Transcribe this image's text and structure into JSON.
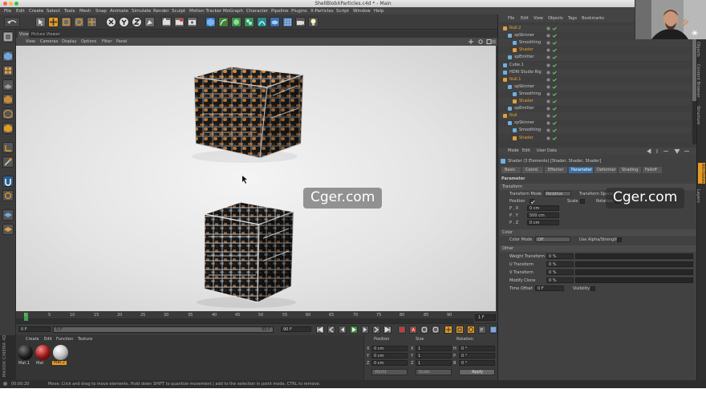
{
  "window": {
    "title": "ShellBlobXParticles.c4d * - Main"
  },
  "menu": [
    "File",
    "Edit",
    "Create",
    "Select",
    "Tools",
    "Mesh",
    "Snap",
    "Animate",
    "Simulate",
    "Render",
    "Sculpt",
    "Motion Tracker",
    "MoGraph",
    "Character",
    "Pipeline",
    "Plugins",
    "X-Particles",
    "Script",
    "Window",
    "Help"
  ],
  "viewport": {
    "tabs": [
      "View",
      "Picture Viewer"
    ],
    "menu": [
      "View",
      "Cameras",
      "Display",
      "Options",
      "Filter",
      "Panel"
    ]
  },
  "timeline": {
    "ticks": [
      "0",
      "5",
      "10",
      "15",
      "20",
      "25",
      "30",
      "35",
      "40",
      "45",
      "50",
      "55",
      "60",
      "65",
      "70",
      "75",
      "80",
      "85",
      "90"
    ],
    "frame_readout": "1 F"
  },
  "transport": {
    "start": "0 F",
    "range_start": "0 F",
    "range_end": "90 F",
    "end": "90 F"
  },
  "material_manager": {
    "menu": [
      "Create",
      "Edit",
      "Function",
      "Texture"
    ],
    "materials": [
      {
        "label": "Mat.1",
        "color": "#1b1b1b"
      },
      {
        "label": "Mat",
        "color": "#8f1414"
      },
      {
        "label": "Mat.2",
        "color": "#c9c9c9"
      }
    ],
    "logo_text": "MAXON CINEMA 4D"
  },
  "coordinates": {
    "headers": [
      "Position",
      "Size",
      "Rotation"
    ],
    "rows": [
      {
        "axis": "X",
        "pos": "0 cm",
        "size_axis": "X",
        "size": "1",
        "rot_axis": "H",
        "rot": "0 °"
      },
      {
        "axis": "Y",
        "pos": "0 cm",
        "size_axis": "Y",
        "size": "1",
        "rot_axis": "P",
        "rot": "0 °"
      },
      {
        "axis": "Z",
        "pos": "0 cm",
        "size_axis": "Z",
        "size": "1",
        "rot_axis": "B",
        "rot": "0 °"
      }
    ],
    "mode": "World",
    "size_mode": "Scale",
    "apply": "Apply"
  },
  "status": {
    "time": "00:00:20",
    "message": "Move: Click and drag to move elements. Hold down SHIFT to quantize movement | add to the selection in point mode, CTRL to remove."
  },
  "object_manager": {
    "menu": [
      "File",
      "Edit",
      "View",
      "Objects",
      "Tags",
      "Bookmarks"
    ],
    "rows": [
      {
        "name": "Null.2",
        "indent": 0,
        "highlight": true
      },
      {
        "name": "xpSkinner",
        "indent": 1,
        "highlight": false
      },
      {
        "name": "Smoothing",
        "indent": 2,
        "highlight": false
      },
      {
        "name": "Shader",
        "indent": 2,
        "highlight": true
      },
      {
        "name": "xpEmitter",
        "indent": 1,
        "highlight": false
      },
      {
        "name": "Cube.1",
        "indent": 0,
        "highlight": false
      },
      {
        "name": "HDRI Studio Rig",
        "indent": 0,
        "highlight": false
      },
      {
        "name": "Null.1",
        "indent": 0,
        "highlight": true
      },
      {
        "name": "xpSkinner",
        "indent": 1,
        "highlight": false
      },
      {
        "name": "Smoothing",
        "indent": 2,
        "highlight": false
      },
      {
        "name": "Shader",
        "indent": 2,
        "highlight": true
      },
      {
        "name": "xpEmitter",
        "indent": 1,
        "highlight": false
      },
      {
        "name": "Null",
        "indent": 0,
        "highlight": true
      },
      {
        "name": "xpSkinner",
        "indent": 1,
        "highlight": false
      },
      {
        "name": "Smoothing",
        "indent": 2,
        "highlight": false
      },
      {
        "name": "Shader",
        "indent": 2,
        "highlight": true
      }
    ]
  },
  "attributes": {
    "menu": [
      "Mode",
      "Edit",
      "User Data"
    ],
    "heading": "Shader (3 Elements) [Shader, Shader, Shader]",
    "tabs": [
      "Basic",
      "Coord.",
      "Effector",
      "Parameter",
      "Deformer",
      "Shading",
      "Falloff"
    ],
    "active_tab": "Parameter",
    "section_parameter": "Parameter",
    "group_transform": "Transform",
    "transform_mode_label": "Transform Mode",
    "transform_mode_value": "Relative",
    "transform_space_label": "Transform Space",
    "position_label": "Position",
    "scale_label": "Scale",
    "rotation_label": "Rotation",
    "px_label": "P . X",
    "px": "0 cm",
    "py_label": "P . Y",
    "py": "500 cm",
    "pz_label": "P . Z",
    "pz": "0 cm",
    "group_color": "Color",
    "color_mode_label": "Color Mode",
    "color_mode_value": "Off",
    "use_alpha_label": "Use Alpha/Strength",
    "group_other": "Other",
    "weight_label": "Weight Transform",
    "weight": "0 %",
    "u_label": "U Transform",
    "u": "0 %",
    "v_label": "V Transform",
    "v": "0 %",
    "clone_label": "Modify Clone",
    "clone": "0 %",
    "time_label": "Time Offset",
    "time": "0 F",
    "visibility_label": "Visibility"
  },
  "right_tabs": [
    "Objects",
    "Content Browser",
    "Structure",
    "Attributes",
    "Layers"
  ],
  "watermarks": [
    "Cger.com",
    "Cger.com"
  ]
}
